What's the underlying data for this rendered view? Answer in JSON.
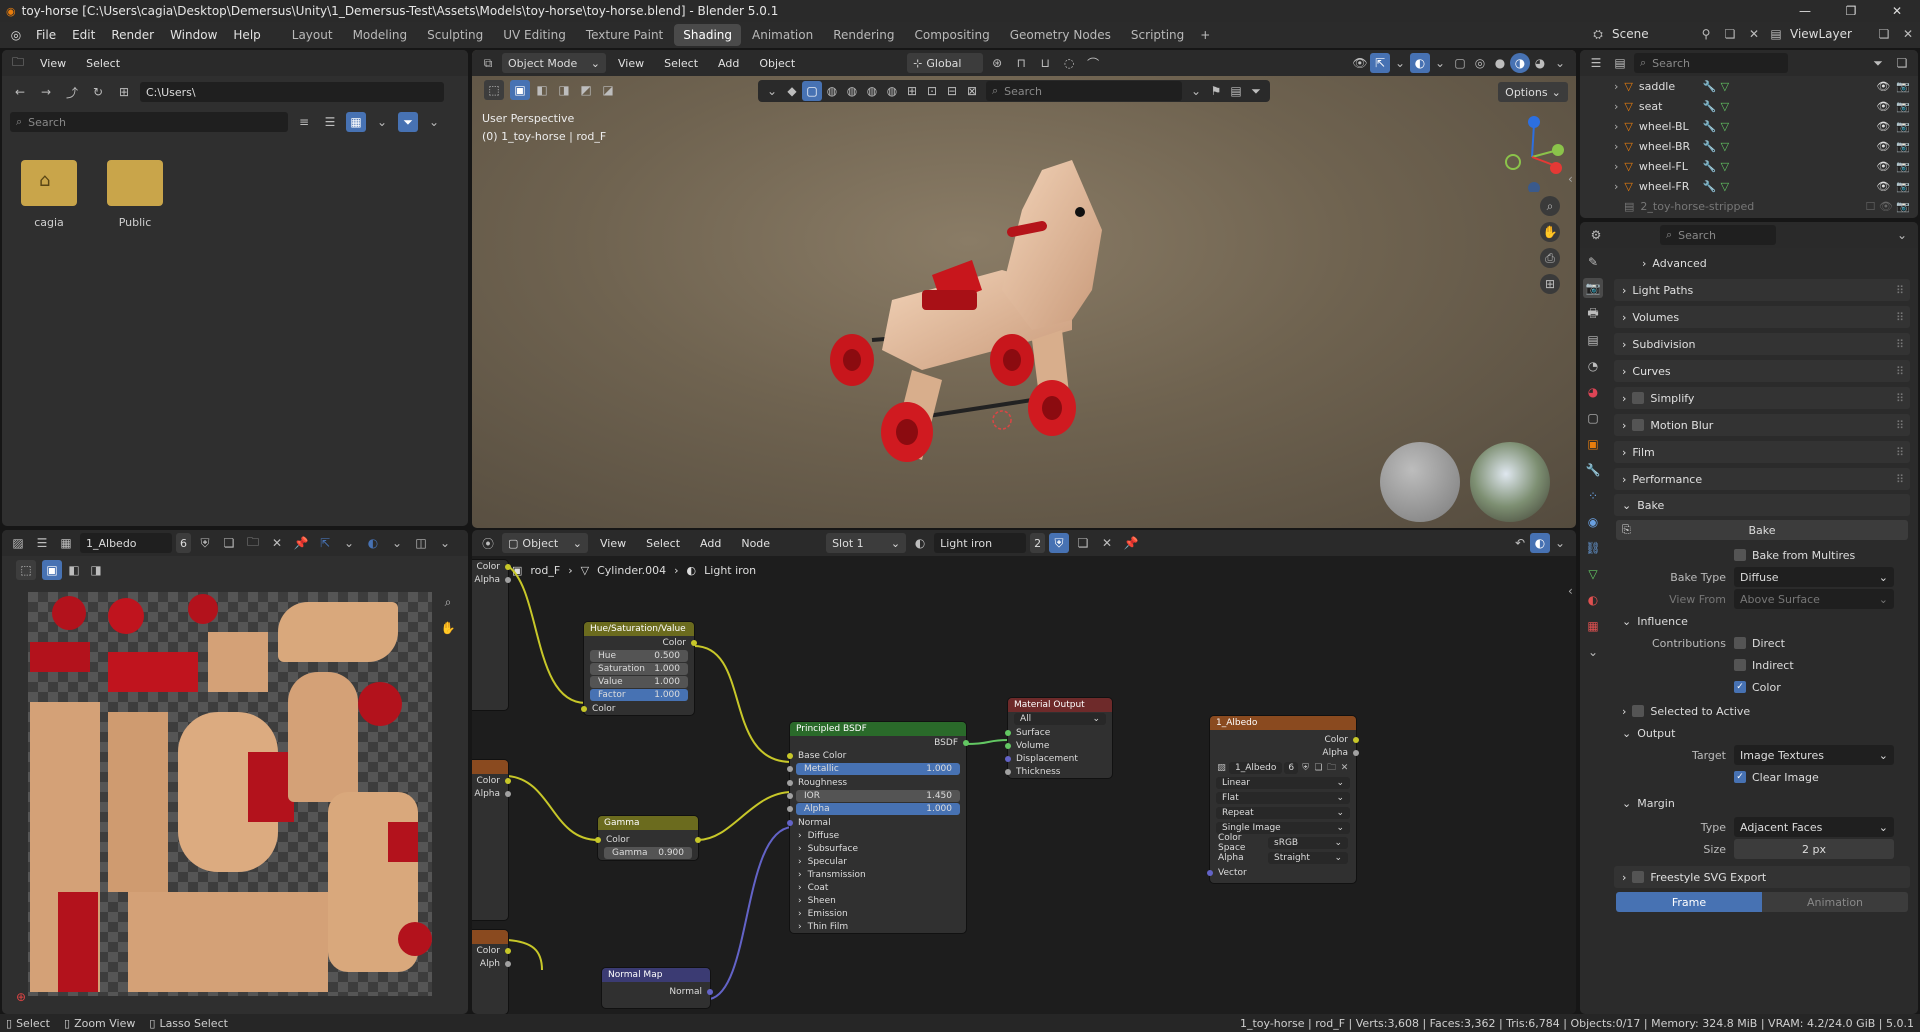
{
  "window": {
    "title": "toy-horse [C:\\Users\\cagia\\Desktop\\Demersus\\Unity\\1_Demersus-Test\\Assets\\Models\\toy-horse\\toy-horse.blend] - Blender 5.0.1"
  },
  "menu": [
    "File",
    "Edit",
    "Render",
    "Window",
    "Help"
  ],
  "workspaces": [
    "Layout",
    "Modeling",
    "Sculpting",
    "UV Editing",
    "Texture Paint",
    "Shading",
    "Animation",
    "Rendering",
    "Compositing",
    "Geometry Nodes",
    "Scripting"
  ],
  "active_workspace": "Shading",
  "scene": {
    "label": "Scene",
    "view_layer": "ViewLayer"
  },
  "file_browser": {
    "menu": [
      "View",
      "Select"
    ],
    "path": "C:\\Users\\",
    "search_placeholder": "Search",
    "folders": [
      "cagia",
      "Public"
    ]
  },
  "viewport": {
    "mode": "Object Mode",
    "menu": [
      "View",
      "Select",
      "Add",
      "Object"
    ],
    "transform": "Global",
    "options_label": "Options",
    "search_placeholder": "Search",
    "overlay_title": "User Perspective",
    "overlay_sub": "(0) 1_toy-horse | rod_F"
  },
  "image_editor": {
    "image_name": "1_Albedo",
    "users": "6"
  },
  "node_editor": {
    "object_label": "Object",
    "menu": [
      "View",
      "Select",
      "Add",
      "Node"
    ],
    "slot": "Slot 1",
    "material": "Light iron",
    "users": "2",
    "breadcrumb": [
      "rod_F",
      "Cylinder.004",
      "Light iron"
    ],
    "nodes": {
      "hsv": {
        "title": "Hue/Saturation/Value",
        "output": "Color",
        "fields": [
          {
            "label": "Hue",
            "value": "0.500"
          },
          {
            "label": "Saturation",
            "value": "1.000"
          },
          {
            "label": "Value",
            "value": "1.000"
          },
          {
            "label": "Factor",
            "value": "1.000"
          }
        ],
        "input": "Color"
      },
      "gamma": {
        "title": "Gamma",
        "color": "Color",
        "gamma_label": "Gamma",
        "gamma_value": "0.900"
      },
      "normalmap": {
        "title": "Normal Map",
        "output": "Normal"
      },
      "bsdf": {
        "title": "Principled BSDF",
        "output": "BSDF",
        "base_color": "Base Color",
        "metallic": {
          "label": "Metallic",
          "value": "1.000"
        },
        "roughness": "Roughness",
        "ior": {
          "label": "IOR",
          "value": "1.450"
        },
        "alpha": {
          "label": "Alpha",
          "value": "1.000"
        },
        "normal": "Normal",
        "subpanels": [
          "Diffuse",
          "Subsurface",
          "Specular",
          "Transmission",
          "Coat",
          "Sheen",
          "Emission",
          "Thin Film"
        ]
      },
      "output": {
        "title": "Material Output",
        "target": "All",
        "inputs": [
          "Surface",
          "Volume",
          "Displacement",
          "Thickness"
        ]
      },
      "albedo": {
        "title": "1_Albedo",
        "outputs": [
          "Color",
          "Alpha"
        ],
        "image": "1_Albedo",
        "users": "6",
        "interp": "Linear",
        "projection": "Flat",
        "extension": "Repeat",
        "source": "Single Image",
        "color_space_label": "Color Space",
        "color_space": "sRGB",
        "alpha_label": "Alpha",
        "alpha": "Straight",
        "vector": "Vector"
      },
      "left_color": "Color",
      "left_alpha": "Alpha",
      "left_color2": "Color",
      "left_alpha2": "Alpha",
      "left_color3": "Color",
      "left_alpha3": "Alph"
    }
  },
  "outliner": {
    "search_placeholder": "Search",
    "items": [
      "saddle",
      "seat",
      "wheel-BL",
      "wheel-BR",
      "wheel-FL",
      "wheel-FR"
    ],
    "collection": "2_toy-horse-stripped"
  },
  "properties": {
    "search_placeholder": "Search",
    "advanced": "Advanced",
    "sections": [
      "Light Paths",
      "Volumes",
      "Subdivision",
      "Curves",
      "Simplify",
      "Motion Blur",
      "Film",
      "Performance"
    ],
    "bake": {
      "title": "Bake",
      "button": "Bake",
      "from_multires": "Bake from Multires",
      "type_label": "Bake Type",
      "type": "Diffuse",
      "view_from_label": "View From",
      "view_from": "Above Surface",
      "influence": "Influence",
      "contributions_label": "Contributions",
      "direct": "Direct",
      "indirect": "Indirect",
      "color": "Color",
      "selected_to_active": "Selected to Active",
      "output": "Output",
      "target_label": "Target",
      "target": "Image Textures",
      "clear_image": "Clear Image",
      "margin": "Margin",
      "margin_type_label": "Type",
      "margin_type": "Adjacent Faces",
      "size_label": "Size",
      "size": "2 px"
    },
    "freestyle": "Freestyle SVG Export",
    "frame_tab": "Frame",
    "animation_tab": "Animation"
  },
  "statusbar": {
    "select": "Select",
    "zoom": "Zoom View",
    "lasso": "Lasso Select",
    "stats": "1_toy-horse | rod_F | Verts:3,608 | Faces:3,362 | Tris:6,784 | Objects:0/17 | Memory: 324.8 MiB | VRAM: 4.2/24.0 GiB | 5.0.1"
  },
  "colors": {
    "accent": "#4772b3",
    "bg": "#161616",
    "panel": "#2f2f2f",
    "header": "#2a2a2a",
    "active_ws": "#4a4a4a",
    "node_color_socket": "#c7c729",
    "node_shader_socket": "#63c763",
    "node_vector_socket": "#6363c7"
  }
}
